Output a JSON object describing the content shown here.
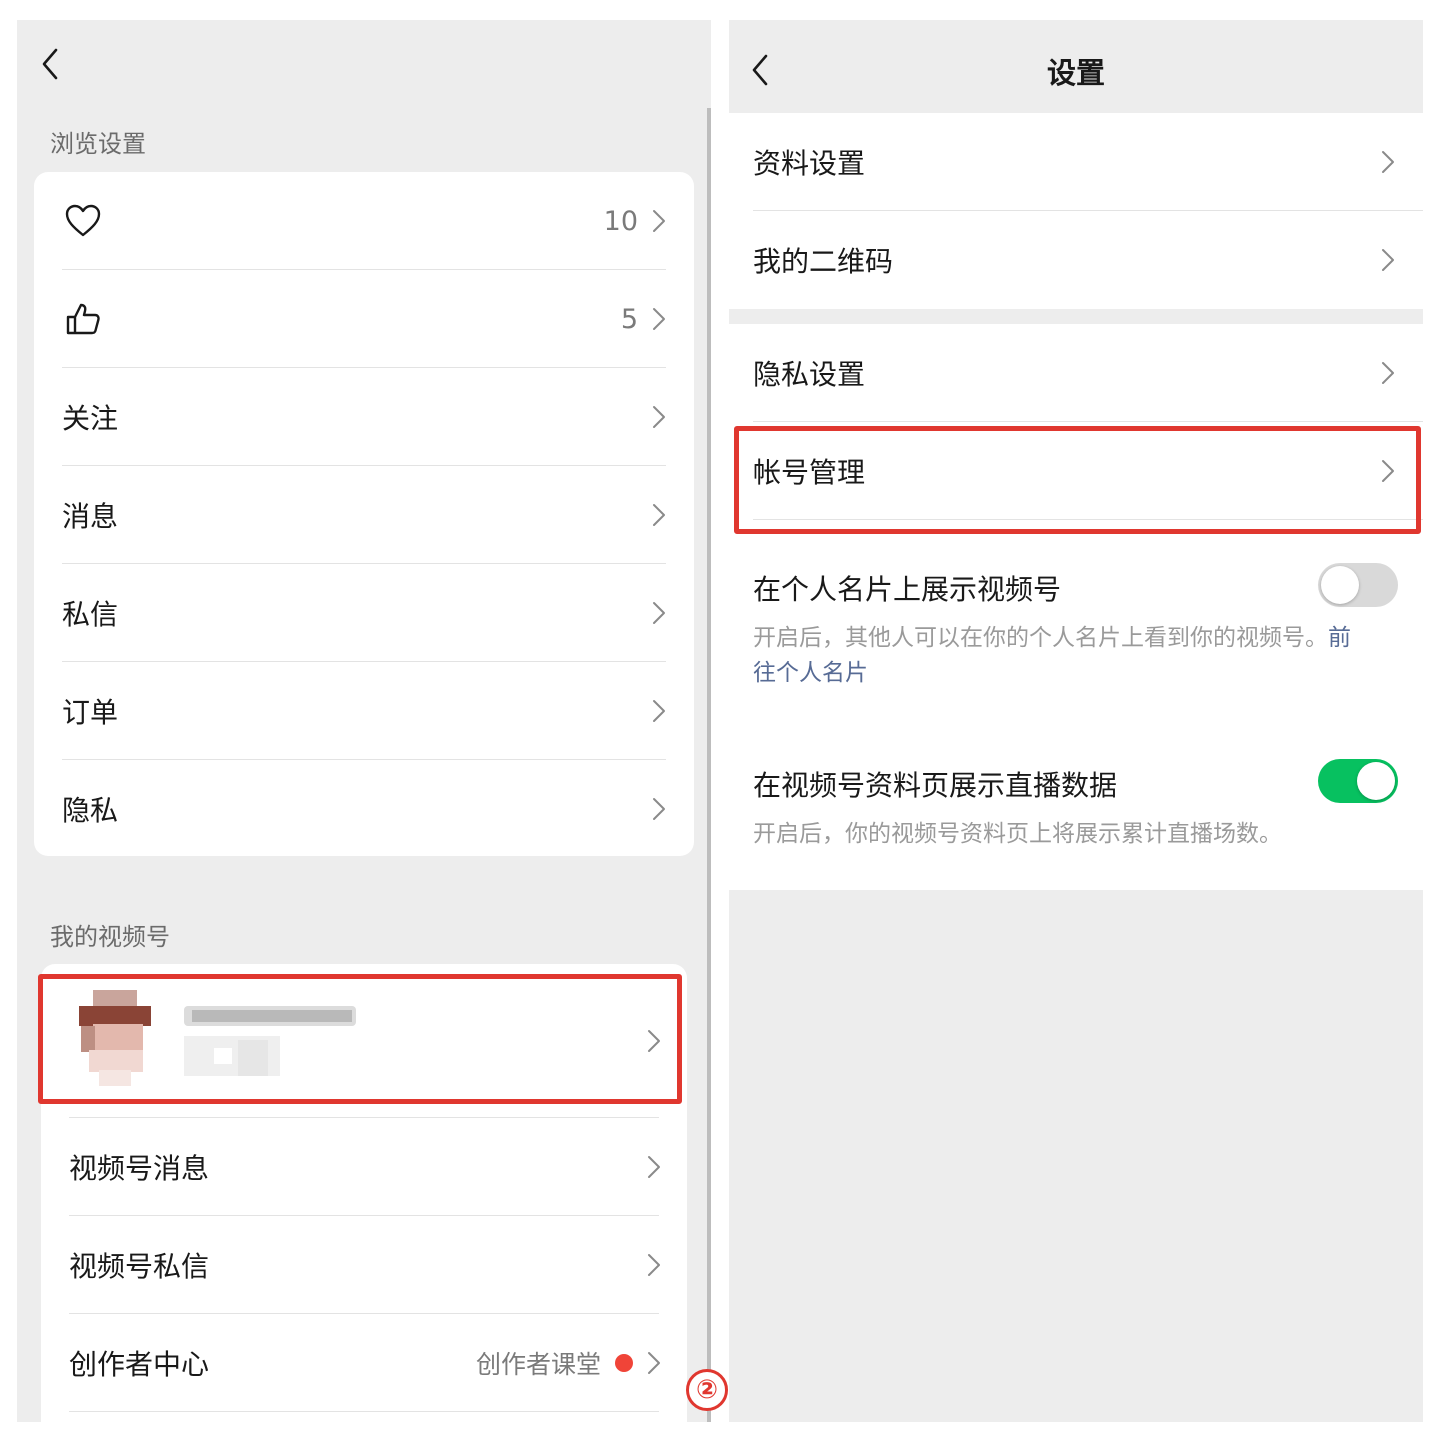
{
  "left": {
    "browse_section_label": "浏览设置",
    "browse_items": [
      {
        "icon": "heart-icon",
        "count": "10"
      },
      {
        "icon": "thumbs-up-icon",
        "count": "5"
      },
      {
        "label": "关注"
      },
      {
        "label": "消息"
      },
      {
        "label": "私信"
      },
      {
        "label": "订单"
      },
      {
        "label": "隐私"
      }
    ],
    "channel_section_label": "我的视频号",
    "channel_items": [
      {
        "label": "视频号消息"
      },
      {
        "label": "视频号私信"
      },
      {
        "label": "创作者中心",
        "extra": "创作者课堂"
      }
    ]
  },
  "right": {
    "title": "设置",
    "group1": [
      {
        "label": "资料设置"
      },
      {
        "label": "我的二维码"
      }
    ],
    "group2": [
      {
        "label": "隐私设置"
      },
      {
        "label": "帐号管理"
      }
    ],
    "toggle1": {
      "label": "在个人名片上展示视频号",
      "desc_line1": "开启后，其他人可以在你的个人名片上看到你的视频号。",
      "link_part1": "前",
      "link_part2": "往个人名片",
      "on": false
    },
    "toggle2": {
      "label": "在视频号资料页展示直播数据",
      "desc": "开启后，你的视频号资料页上将展示累计直播场数。",
      "on": true
    }
  },
  "badge": "②",
  "colors": {
    "highlight": "#e0372f",
    "toggle_on": "#07c160",
    "toggle_off": "#d9d9d9",
    "link": "#576b95",
    "red_dot": "#f04438"
  }
}
